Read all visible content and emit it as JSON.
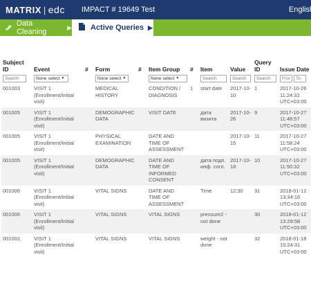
{
  "header": {
    "logo_left": "MATRIX",
    "logo_sep": "|",
    "logo_right": "edc",
    "study": "IMPACT # 19649 Test",
    "lang": "English"
  },
  "tabs": [
    {
      "label": "Data Cleaning",
      "arrow": "▶"
    },
    {
      "label": "Active Queries",
      "arrow": "▶"
    }
  ],
  "table": {
    "headers": {
      "subject_id": "Subject ID",
      "event": "Event",
      "event_num": "#",
      "form": "Form",
      "form_num": "#",
      "item_group": "Item Group",
      "ig_num": "#",
      "item": "Item",
      "value": "Value",
      "query_id": "Query ID",
      "issue_date": "Issue Date"
    },
    "filters": {
      "search": "Search",
      "none_select": "None select",
      "from": "From",
      "to": "To"
    },
    "rows": [
      {
        "subject_id": "001003",
        "event": "VISIT 1 (Enrollment/Initial visit)",
        "form": "MEDICAL HISTORY",
        "item_group": "CONDITION / DIAGNOSIS",
        "ig_num": "1",
        "item": "start date",
        "value": "2017-10-10",
        "query_id": "1",
        "issue_date": "2017-10-26 11:24:32 UTC+03:00"
      },
      {
        "subject_id": "001005",
        "event": "VISIT 1 (Enrollment/Initial visit)",
        "form": "DEMOGRAPHIC DATA",
        "item_group": "VISIT DATE",
        "ig_num": "",
        "item": "дата визита",
        "value": "2017-10-26",
        "query_id": "9",
        "issue_date": "2017-10-27 11:48:57 UTC+03:00"
      },
      {
        "subject_id": "001005",
        "event": "VISIT 1 (Enrollment/Initial visit)",
        "form": "PHYSICAL EXAMINATION",
        "item_group": "DATE AND TIME OF ASSESSMENT",
        "ig_num": "",
        "item": "",
        "value": "2017-10-15",
        "query_id": "11",
        "issue_date": "2017-10-27 11:58:24 UTC+03:00"
      },
      {
        "subject_id": "001005",
        "event": "VISIT 1 (Enrollment/Initial visit)",
        "form": "DEMOGRAPHIC DATA",
        "item_group": "DATE AND TIME OF INFORMED CONSENT",
        "ig_num": "",
        "item": "дата подп. инф. согл.",
        "value": "2017-10-18",
        "query_id": "10",
        "issue_date": "2017-10-27 11:50:32 UTC+03:00"
      },
      {
        "subject_id": "001006",
        "event": "VISIT 1 (Enrollment/Initial visit)",
        "form": "VITAL SIGNS",
        "item_group": "DATE AND TIME OF ASSESSMENT",
        "ig_num": "",
        "item": "Time",
        "value": "12:30",
        "query_id": "31",
        "issue_date": "2018-01-12 13:34:16 UTC+03:00"
      },
      {
        "subject_id": "001006",
        "event": "VISIT 1 (Enrollment/Initial visit)",
        "form": "VITAL SIGNS",
        "item_group": "VITAL SIGNS",
        "ig_num": "",
        "item": "pressure2 - not done",
        "value": "",
        "query_id": "30",
        "issue_date": "2018-01-12 13:29:58 UTC+03:00"
      },
      {
        "subject_id": "001002",
        "event": "VISIT 1 (Enrollment/Initial visit)",
        "form": "VITAL SIGNS",
        "item_group": "VITAL SIGNS",
        "ig_num": "",
        "item": "weight - not done",
        "value": "",
        "query_id": "32",
        "issue_date": "2018-01-18 15:24:31 UTC+03:00"
      }
    ]
  },
  "colors": {
    "header_bg": "#1f3a6e",
    "tab_bg": "#7cb82f"
  },
  "icons": {
    "tab1": "clean-icon",
    "tab2": "document-icon"
  }
}
